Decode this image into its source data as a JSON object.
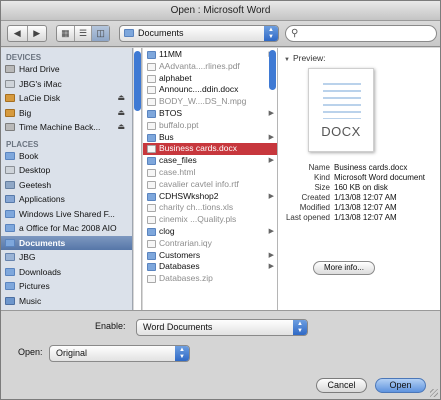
{
  "window": {
    "title": "Open : Microsoft Word"
  },
  "toolbar": {
    "back_icon": "back-arrow-icon",
    "forward_icon": "forward-arrow-icon",
    "location": "Documents",
    "search_value": ""
  },
  "sidebar": {
    "devices_header": "DEVICES",
    "devices": [
      {
        "label": "Hard Drive",
        "icon": "drive"
      },
      {
        "label": "JBG's iMac",
        "icon": "mac"
      },
      {
        "label": "LaCie Disk",
        "icon": "lacie"
      },
      {
        "label": "Big",
        "icon": "lacie"
      },
      {
        "label": "Time Machine Back...",
        "icon": "drive"
      }
    ],
    "places_header": "PLACES",
    "places": [
      {
        "label": "Book",
        "icon": "folder"
      },
      {
        "label": "Desktop",
        "icon": "mac"
      },
      {
        "label": "Geetesh",
        "icon": "net"
      },
      {
        "label": "Applications",
        "icon": "app"
      },
      {
        "label": "Windows Live Shared F...",
        "icon": "folder"
      },
      {
        "label": "a Office for Mac 2008 AIO",
        "icon": "folder"
      },
      {
        "label": "Documents",
        "icon": "folder"
      },
      {
        "label": "JBG",
        "icon": "home"
      },
      {
        "label": "Downloads",
        "icon": "folder"
      },
      {
        "label": "Pictures",
        "icon": "folder"
      },
      {
        "label": "Music",
        "icon": "music"
      }
    ]
  },
  "files": [
    {
      "name": "11MM",
      "kind": "folder",
      "dim": false,
      "arrow": true
    },
    {
      "name": "AAdvanta....rlines.pdf",
      "kind": "doc",
      "dim": true,
      "arrow": false
    },
    {
      "name": "alphabet",
      "kind": "doc",
      "dim": false,
      "arrow": false
    },
    {
      "name": "Announc....ddin.docx",
      "kind": "doc",
      "dim": false,
      "arrow": false
    },
    {
      "name": "BODY_W....DS_N.mpg",
      "kind": "doc",
      "dim": true,
      "arrow": false
    },
    {
      "name": "BTOS",
      "kind": "folder",
      "dim": false,
      "arrow": true
    },
    {
      "name": "buffalo.ppt",
      "kind": "doc",
      "dim": true,
      "arrow": false
    },
    {
      "name": "Bus",
      "kind": "folder",
      "dim": false,
      "arrow": true
    },
    {
      "name": "Business cards.docx",
      "kind": "doc",
      "dim": false,
      "arrow": false,
      "selected": true
    },
    {
      "name": "case_files",
      "kind": "folder",
      "dim": false,
      "arrow": true
    },
    {
      "name": "case.html",
      "kind": "doc",
      "dim": true,
      "arrow": false
    },
    {
      "name": "cavalier cavtel info.rtf",
      "kind": "doc",
      "dim": true,
      "arrow": false
    },
    {
      "name": "CDHSWkshop2",
      "kind": "folder",
      "dim": false,
      "arrow": true
    },
    {
      "name": "charity ch...tions.xls",
      "kind": "doc",
      "dim": true,
      "arrow": false
    },
    {
      "name": "cinemix ...Quality.pls",
      "kind": "doc",
      "dim": true,
      "arrow": false
    },
    {
      "name": "clog",
      "kind": "folder",
      "dim": false,
      "arrow": true
    },
    {
      "name": "Contrarian.iqy",
      "kind": "doc",
      "dim": true,
      "arrow": false
    },
    {
      "name": "Customers",
      "kind": "folder",
      "dim": false,
      "arrow": true
    },
    {
      "name": "Databases",
      "kind": "folder",
      "dim": false,
      "arrow": true
    },
    {
      "name": "Databases.zip",
      "kind": "doc",
      "dim": true,
      "arrow": false
    }
  ],
  "preview": {
    "header": "Preview:",
    "thumb_label": "DOCX",
    "info": [
      {
        "key": "Name",
        "value": "Business cards.docx"
      },
      {
        "key": "Kind",
        "value": "Microsoft Word document"
      },
      {
        "key": "Size",
        "value": "160 KB on disk"
      },
      {
        "key": "Created",
        "value": "1/13/08 12:07 AM"
      },
      {
        "key": "Modified",
        "value": "1/13/08 12:07 AM"
      },
      {
        "key": "Last opened",
        "value": "1/13/08 12:07 AM"
      }
    ],
    "more_info_label": "More info..."
  },
  "bottom": {
    "enable_label": "Enable:",
    "enable_value": "Word Documents",
    "open_label": "Open:",
    "open_value": "Original",
    "cancel_label": "Cancel",
    "open_button_label": "Open"
  },
  "colors": {
    "selection_red": "#c7373d",
    "sidebar_bg": "#dbe1ea",
    "sidebar_selected": "#5676a8",
    "primary_button": "#5e93de"
  }
}
